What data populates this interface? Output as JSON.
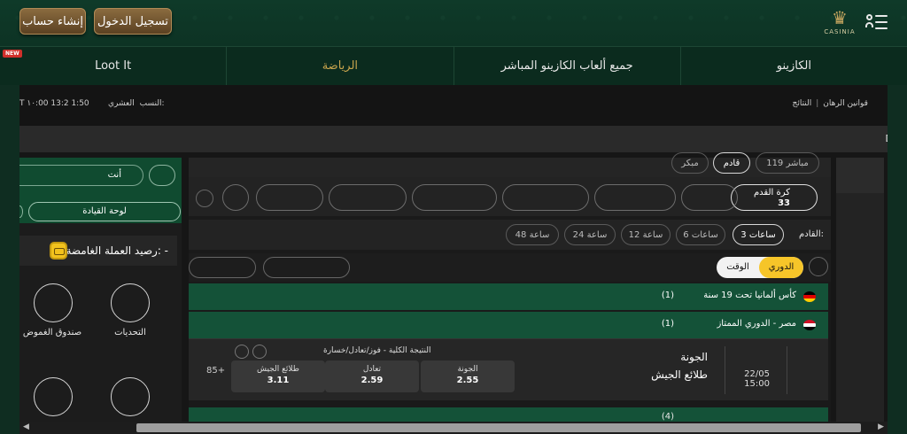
{
  "header": {
    "register_label": "إنشاء حساب",
    "login_label": "تسجيل الدخول",
    "logo_text": "CASINIA",
    "logo_icon": "crown-icon",
    "menu_icon": "user-menu-icon"
  },
  "nav": {
    "items": [
      {
        "label": "الكازينو",
        "active": false
      },
      {
        "label": "جميع ألعاب الكازينو المباشر",
        "active": false
      },
      {
        "label": "الرياضة",
        "active": true
      },
      {
        "label": "Loot It",
        "active": false,
        "badge": "NEW"
      }
    ]
  },
  "infobar": {
    "times": "T ١٠:00 13:2 1:50",
    "odds_label": "النسب:",
    "odds_value": "العشري",
    "results_link": "النتائج",
    "rules_link": "قوانين الرهان"
  },
  "darkband": {
    "edge_text": "D"
  },
  "leftpanel": {
    "search_placeholder": "أنت",
    "leaderboard_label": "لوحة القيادة",
    "balance_label": "رصيد العملة الغامضة: -",
    "circles": [
      {
        "label": "التحديات"
      },
      {
        "label": "صندوق الغموض"
      }
    ]
  },
  "center": {
    "top_pills": [
      {
        "label": "مباشر  119",
        "selected": false
      },
      {
        "label": "قادم",
        "selected": true
      },
      {
        "label": "مبكر",
        "selected": false
      }
    ],
    "sport": {
      "name": "كرة القدم",
      "count": "33"
    },
    "time_label": "القادم:",
    "time_filters": [
      {
        "label": "3 ساعات",
        "selected": true
      },
      {
        "label": "6 ساعات",
        "selected": false
      },
      {
        "label": "12 ساعة",
        "selected": false
      },
      {
        "label": "24 ساعة",
        "selected": false
      },
      {
        "label": "48 ساعة",
        "selected": false
      }
    ],
    "tabs": {
      "league": "الدوري",
      "time": "الوقت"
    },
    "leagues": [
      {
        "name": "كأس ألمانيا تحت 19 سنة",
        "count": "(1)",
        "flag": "germany-flag-icon"
      },
      {
        "name": "مصر - الدوري الممتاز",
        "count": "(1)",
        "flag": "egypt-flag-icon"
      }
    ],
    "match": {
      "date": "22/05",
      "time": "15:00",
      "home": "الجونة",
      "away": "طلائع الجيش",
      "market": "النتيجة الكلية - فوز/تعادل/خسارة",
      "odds": [
        {
          "label": "الجونة",
          "value": "2.55"
        },
        {
          "label": "تعادل",
          "value": "2.59"
        },
        {
          "label": "طلائع الجيش",
          "value": "3.11"
        }
      ],
      "more": "85+"
    },
    "bottom_league_partial": "(4)"
  }
}
